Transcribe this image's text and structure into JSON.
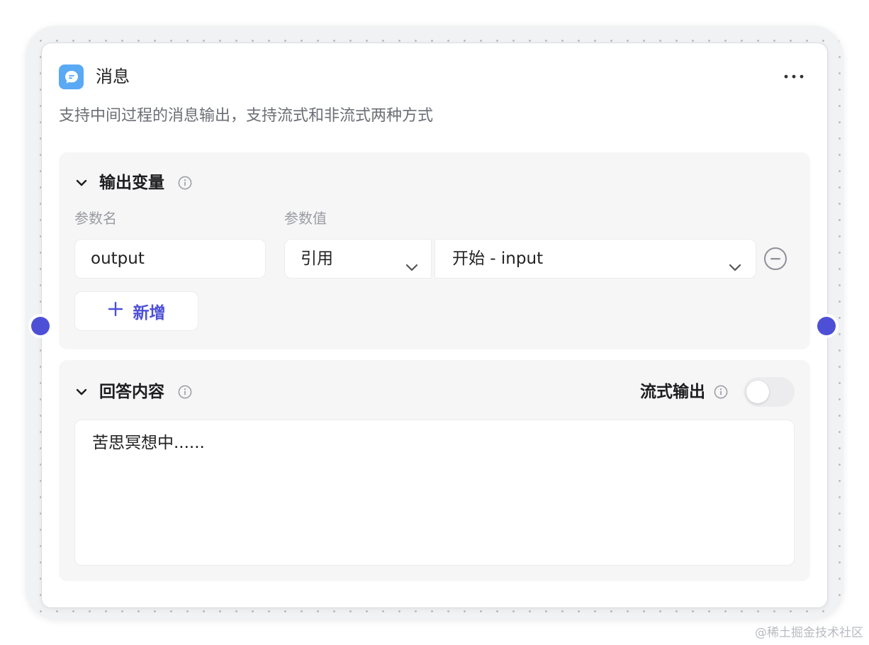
{
  "colors": {
    "accent": "#4d50d6",
    "port": "#4d50d6",
    "icon_bg": "#5aa9f5"
  },
  "node": {
    "icon": "message-icon",
    "title": "消息",
    "more_icon": "more-horizontal-icon",
    "description": "支持中间过程的消息输出，支持流式和非流式两种方式"
  },
  "output_section": {
    "title": "输出变量",
    "col_name_label": "参数名",
    "col_value_label": "参数值",
    "param_name": "output",
    "value_type": "引用",
    "value_ref": "开始 - input",
    "add_label": "新增"
  },
  "answer_section": {
    "title": "回答内容",
    "stream_label": "流式输出",
    "stream_enabled": false,
    "content": "苦思冥想中......"
  },
  "watermark": "@稀土掘金技术社区"
}
